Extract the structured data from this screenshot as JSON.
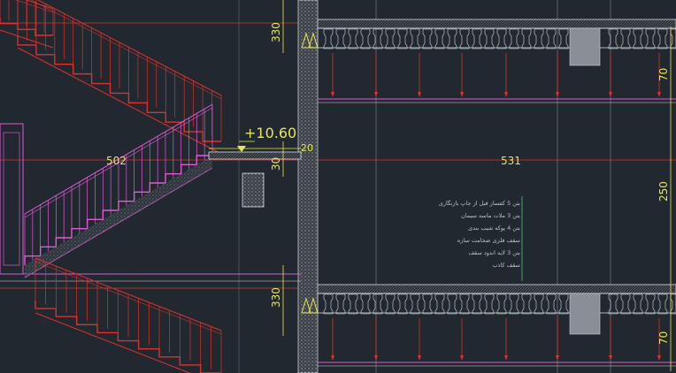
{
  "drawing": {
    "elevation_label": "+10.60",
    "dimensions": {
      "top_vertical": "330",
      "bottom_vertical": "330",
      "slab_offset": "30",
      "landing_gap": "20",
      "left_span": "502",
      "right_span": "531",
      "right_top": "70",
      "right_middle": "250",
      "right_bottom": "70"
    },
    "layer_notes": [
      "بتن 5 کفساز قبل از جاپ بازنگاری",
      "بتن 3 ملات ماسه سیمان",
      "بتن 4 پوکه شیب بندی",
      "سقف فلزی ضخامت سازه",
      "بتن 3 لایه اندود سقف",
      "سقف کاذب"
    ],
    "colors": {
      "background": "#212830",
      "stair_magenta": "#e05ad6",
      "railing_red": "#e0302a",
      "dimension_yellow": "#e8e84a",
      "structure_grey": "#8a8f96",
      "hatch_white": "#d8dde2",
      "green_leader": "#3fcf6a"
    }
  }
}
